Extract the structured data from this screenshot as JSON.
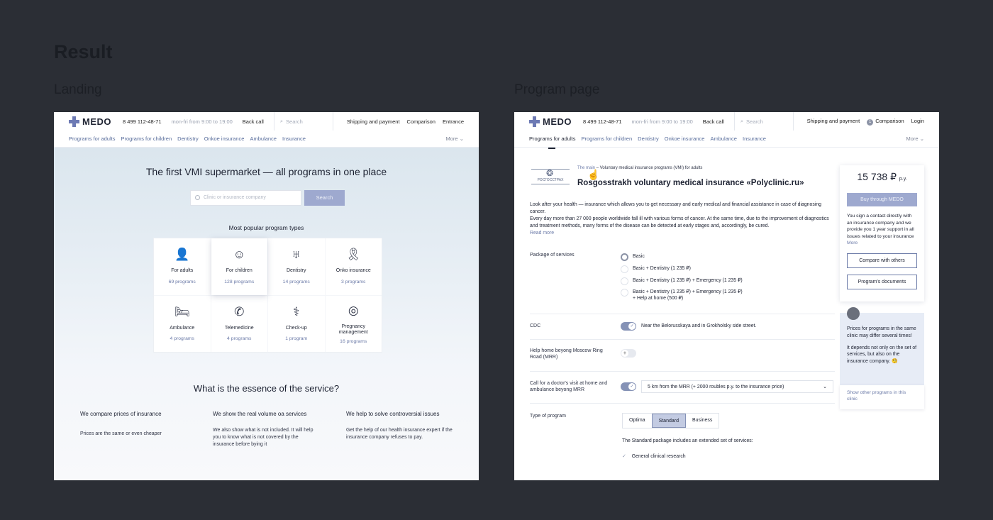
{
  "page": {
    "title": "Result",
    "landing_label": "Landing",
    "program_label": "Program page"
  },
  "header": {
    "brand": "MEDO",
    "phone": "8 499 112-48-71",
    "hours": "mon-fri from 9:00 to 19:00",
    "back_call": "Back call",
    "search_placeholder": "Search",
    "shipping": "Shipping and payment",
    "comparison": "Comparison",
    "entrance": "Entrance",
    "login": "Login",
    "comparison_count": "1"
  },
  "nav": {
    "items": [
      "Programs for adults",
      "Programs for children",
      "Dentistry",
      "Onkoe insurance",
      "Ambulance",
      "Insurance"
    ],
    "more": "More"
  },
  "landing": {
    "hero_title": "The first VMI supermarket — all programs in one place",
    "search_placeholder": "Clinic or insurance company",
    "search_button": "Search",
    "popular_title": "Most popular program types",
    "types": [
      {
        "name": "For adults",
        "count": "69 programs",
        "icon": "adult-icon"
      },
      {
        "name": "For children",
        "count": "128 programs",
        "icon": "child-icon"
      },
      {
        "name": "Dentistry",
        "count": "14 programs",
        "icon": "tooth-icon"
      },
      {
        "name": "Onko insurance",
        "count": "3 programs",
        "icon": "ribbon-icon"
      },
      {
        "name": "Ambulance",
        "count": "4 programs",
        "icon": "bed-icon"
      },
      {
        "name": "Telemedicine",
        "count": "4 programs",
        "icon": "phone-icon"
      },
      {
        "name": "Check-up",
        "count": "1 program",
        "icon": "doctor-icon"
      },
      {
        "name": "Pregnancy management",
        "count": "16 programs",
        "icon": "pregnancy-icon"
      }
    ],
    "essence_title": "What is the essence of the service?",
    "essence": [
      {
        "title": "We compare prices of insurance",
        "text": "Prices are the same or even cheaper"
      },
      {
        "title": "We show the real volume oa services",
        "text": "We also show what is not included. It will help you to know what is not covered by the insurance before bying it"
      },
      {
        "title": "We help to solve controversial issues",
        "text": "Get the help of our health insurance expert if the insurance company refuses to pay."
      }
    ]
  },
  "program": {
    "crumb_link": "The main",
    "crumb_current": "Voluntary medical insurance programs (VMI) for adults",
    "company_logo_text": "РОСГОССТРАХ",
    "title": "Rosgosstrakh voluntary medical insurance «Polyclinic.ru»",
    "desc1": "Look after your health — insurance which allows you to get necessary and early medical and financial assistance in case of diagnosing cancer.",
    "desc2": "Every day more than 27 000 people worldwide fall ill with various forms of cancer. At the same time, due to the improvement of diagnostics and treatment methods, many forms of the disease can be detected at early stages and, accordingly, be cured.",
    "read_more": "Read more",
    "package_label": "Package of services",
    "packages": [
      "Basic",
      "Basic + Dentistry (1 235 ₽)",
      "Basic + Dentistry (1 235 ₽) + Emergency (1 235 ₽)",
      "Basic + Dentistry (1 235 ₽) + Emergency (1 235 ₽)",
      "+ Help at home (500 ₽)"
    ],
    "cdc_label": "CDC",
    "cdc_text": "Near the Belorusskaya and in Grokholsky side street.",
    "help_label": "Help home beyong Moscow Ring Road (MRR)",
    "call_label": "Call for a doctor's visit at home and ambulance beyong MRR",
    "call_select": "5 km from the MRR (+ 2000 roubles p.y. to the insurance price)",
    "type_label": "Type of program",
    "types": [
      "Optima",
      "Standard",
      "Business"
    ],
    "selected_type": "Standard",
    "std_note": "The Standard package includes an extended set of services:",
    "check_item": "General clinical research",
    "price": "15 738 ₽",
    "price_unit": "p.y.",
    "buy_button": "Buy through MEDO",
    "side_text": "You sign a contact  directly with an insurance company and we provide you 1 year support in all issues related to your insurance",
    "side_more": "More",
    "compare_button": "Compare with others",
    "documents_button": "Program's documents",
    "chat_text1": "Prices for programs in the same clinic may differ several times!",
    "chat_text2": "It depends not only on the set of services, but also on the insurance company. 🧐",
    "chat_link": "Show other programs in this clinic"
  }
}
